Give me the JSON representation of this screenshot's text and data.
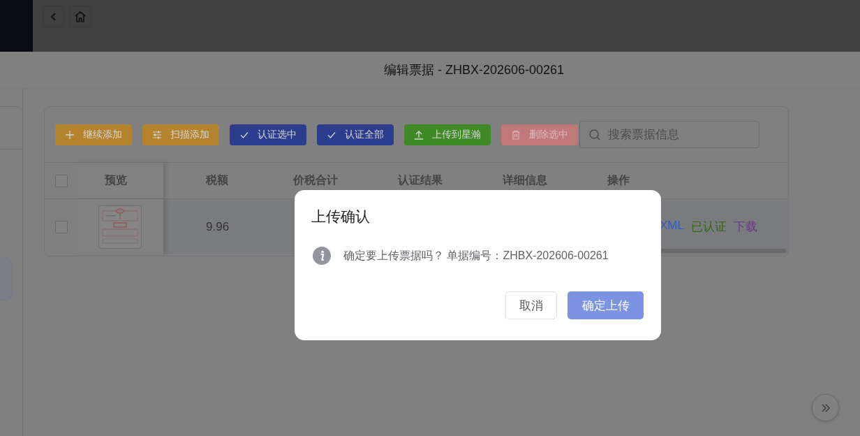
{
  "drawer": {
    "title": "编辑票据 - ZHBX-202606-00261"
  },
  "toolbar": {
    "buttons": [
      {
        "label": "继续添加",
        "kind": "add",
        "color": "#b3832e",
        "disabled": false
      },
      {
        "label": "扫描添加",
        "kind": "scan",
        "color": "#b3832e",
        "disabled": false
      },
      {
        "label": "认证选中",
        "kind": "check",
        "color": "#2b3d8c",
        "disabled": false
      },
      {
        "label": "认证全部",
        "kind": "check",
        "color": "#2b3d8c",
        "disabled": false
      },
      {
        "label": "上传到星瀚",
        "kind": "upload",
        "color": "#3f8a26",
        "disabled": false
      },
      {
        "label": "删除选中",
        "kind": "delete",
        "color": "#c07878",
        "disabled": true
      }
    ],
    "search": {
      "placeholder": "搜索票据信息"
    }
  },
  "table": {
    "header_checked": false,
    "columns": [
      "预览",
      "税额",
      "价税合计",
      "认证结果",
      "详细信息",
      "操作"
    ],
    "rows": [
      {
        "checked": false,
        "tax": "9.96",
        "actions": [
          {
            "label": "XML",
            "color": "#2f5fb8"
          },
          {
            "label": "已认证",
            "color": "#336814"
          },
          {
            "label": "下载",
            "color": "#6a3a86"
          }
        ]
      }
    ]
  },
  "dialog": {
    "title": "上传确认",
    "message": "确定要上传票据吗？ 单据编号：ZHBX-202606-00261",
    "buttons": [
      {
        "label": "取消",
        "kind": "secondary"
      },
      {
        "label": "确定上传",
        "kind": "primary"
      }
    ]
  }
}
